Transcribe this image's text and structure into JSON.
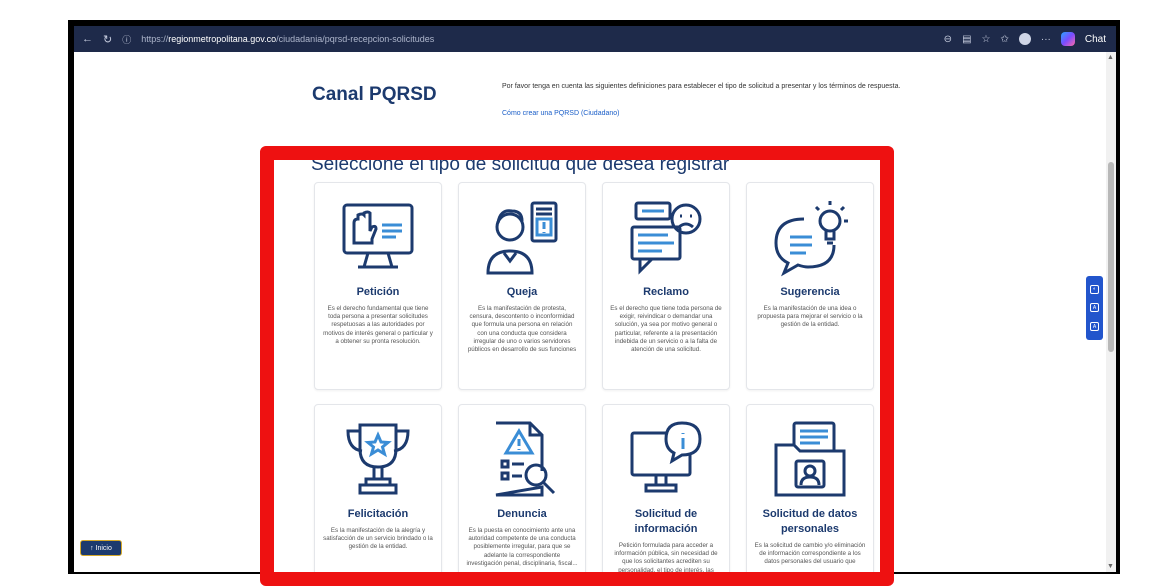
{
  "browser": {
    "url_prefix": "https://",
    "url_domain": "regionmetropolitana.gov.co",
    "url_path": "/ciudadania/pqrsd-recepcion-solicitudes",
    "chat_label": "Chat"
  },
  "page": {
    "title": "Canal PQRSD",
    "intro": "Por favor tenga en cuenta las siguientes definiciones para establecer el tipo de solicitud a presentar y los términos de respuesta.",
    "intro_link": "Cómo crear una PQRSD (Ciudadano)",
    "subtitle": "Seleccione el tipo de solicitud que desea registrar"
  },
  "cards": [
    {
      "name": "Petición",
      "icon": "monitor-hand-icon",
      "desc": "Es el derecho fundamental que tiene toda persona a presentar solicitudes respetuosas a las autoridades por motivos de interés general o particular y a obtener su pronta resolución."
    },
    {
      "name": "Queja",
      "icon": "person-alert-icon",
      "desc": "Es la manifestación de protesta, censura, descontento o inconformidad que formula una persona en relación con una conducta que considera irregular de uno o varios servidores públicos en desarrollo de sus funciones"
    },
    {
      "name": "Reclamo",
      "icon": "chat-sad-icon",
      "desc": "Es el derecho que tiene toda persona de exigir, reivindicar o demandar una solución, ya sea por motivo general o particular, referente a la presentación indebida de un servicio o a la falta de atención de una solicitud."
    },
    {
      "name": "Sugerencia",
      "icon": "chat-bulb-icon",
      "desc": "Es la manifestación de una idea o propuesta para mejorar el servicio o la gestión de la entidad."
    },
    {
      "name": "Felicitación",
      "icon": "trophy-icon",
      "desc": "Es la manifestación de la alegría y satisfacción de un servicio brindado o la gestión de la entidad."
    },
    {
      "name": "Denuncia",
      "icon": "document-search-icon",
      "desc": "Es la puesta en conocimiento ante una autoridad competente de una conducta posiblemente irregular, para que se adelante la correspondiente investigación penal, disciplinaria, fiscal..."
    },
    {
      "name": "Solicitud de información",
      "icon": "computer-info-icon",
      "desc": "Petición formulada para acceder a información pública, sin necesidad de que los solicitantes acrediten su personalidad, el tipo de interés, las"
    },
    {
      "name": "Solicitud de datos personales",
      "icon": "folder-person-icon",
      "desc": "Es la solicitud de cambio y/o eliminación de información correspondiente a los datos personales del usuario que"
    }
  ],
  "home_button": "↑ Inicio",
  "colors": {
    "brand": "#1c3a6e",
    "highlight": "#ee1111",
    "toolbar": "#2255cc"
  }
}
